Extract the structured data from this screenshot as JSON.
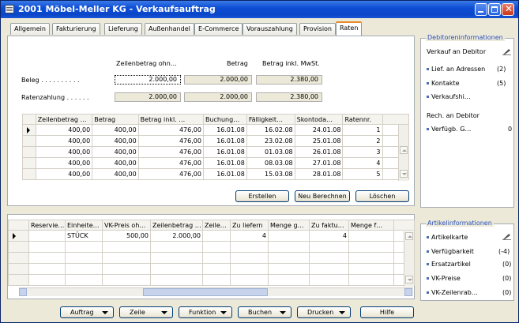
{
  "window": {
    "title": "2001 Möbel-Meller KG - Verkaufsauftrag"
  },
  "tabs": [
    "Allgemein",
    "Fakturierung",
    "Lieferung",
    "Außenhandel",
    "E-Commerce",
    "Vorauszahlung",
    "Provision",
    "Raten"
  ],
  "summary": {
    "col_headers": [
      "Zeilenbetrag ohn…",
      "Betrag",
      "Betrag inkl. MwSt."
    ],
    "rows": [
      {
        "label": "Beleg . . . . . . . . . .",
        "values": [
          "2.000,00",
          "2.000,00",
          "2.380,00"
        ]
      },
      {
        "label": "Ratenzahlung . . . . . .",
        "values": [
          "2.000,00",
          "2.000,00",
          "2.380,00"
        ]
      }
    ]
  },
  "raten_grid": {
    "headers": [
      "Zeilenbetrag …",
      "Betrag",
      "Betrag inkl. …",
      "Buchung…",
      "Fälligkeit…",
      "Skontoda…",
      "Ratennr."
    ],
    "rows": [
      [
        "400,00",
        "400,00",
        "476,00",
        "16.01.08",
        "16.02.08",
        "24.01.08",
        "1"
      ],
      [
        "400,00",
        "400,00",
        "476,00",
        "16.01.08",
        "23.02.08",
        "25.01.08",
        "2"
      ],
      [
        "400,00",
        "400,00",
        "476,00",
        "16.01.08",
        "01.03.08",
        "26.01.08",
        "3"
      ],
      [
        "400,00",
        "400,00",
        "476,00",
        "16.01.08",
        "08.03.08",
        "27.01.08",
        "4"
      ],
      [
        "400,00",
        "400,00",
        "476,00",
        "16.01.08",
        "15.03.08",
        "28.01.08",
        "5"
      ]
    ]
  },
  "raten_buttons": {
    "create": "Erstellen",
    "recalc": "Neu Berechnen",
    "delete": "Löschen"
  },
  "lines_grid": {
    "headers": [
      "Reservie…",
      "Einheite…",
      "VK-Preis oh…",
      "Zeilenbetrag …",
      "Zeile…",
      "Zu liefern",
      "Menge g…",
      "Zu faktu…",
      "Menge f…"
    ],
    "rows": [
      [
        "",
        "STÜCK",
        "500,00",
        "2.000,00",
        "",
        "4",
        "",
        "4",
        ""
      ]
    ]
  },
  "debitor": {
    "header": "Debitoreninformationen",
    "title1": "Verkauf an Debitor",
    "items1": [
      {
        "label": "Lief. an Adressen",
        "value": "(2)"
      },
      {
        "label": "Kontakte",
        "value": "(5)"
      },
      {
        "label": "Verkaufshi…",
        "value": ""
      }
    ],
    "title2": "Rech. an Debitor",
    "items2": [
      {
        "label": "Verfügb. G…",
        "value": "0"
      }
    ]
  },
  "artikel": {
    "header": "Artikelinformationen",
    "items": [
      {
        "label": "Artikelkarte",
        "value": ""
      },
      {
        "label": "Verfügbarkeit",
        "value": "(-4)"
      },
      {
        "label": "Ersatzartikel",
        "value": "(0)"
      },
      {
        "label": "VK-Preise",
        "value": "(0)"
      },
      {
        "label": "VK-Zeilenrab…",
        "value": "(0)"
      }
    ]
  },
  "bottom_buttons": {
    "auftrag": "Auftrag",
    "zeile": "Zeile",
    "funktion": "Funktion",
    "buchen": "Buchen",
    "drucken": "Drucken",
    "hilfe": "Hilfe"
  },
  "colors": {
    "titlebar": "#0a46c8",
    "active_tab": "#e68b2c",
    "side_header": "#2a52be"
  }
}
